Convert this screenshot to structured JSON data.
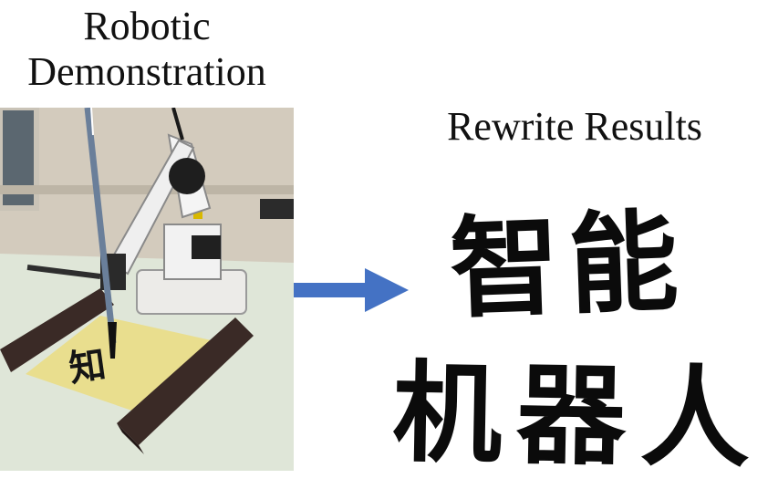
{
  "left_panel": {
    "title_line1": "Robotic",
    "title_line2": "Demonstration",
    "photo_written_char": "知"
  },
  "right_panel": {
    "title": "Rewrite Results",
    "calligraphy_line1": "智能",
    "calligraphy_line2": "机器人"
  },
  "colors": {
    "arrow": "#4472C4",
    "paper": "#E9DE8E",
    "felt": "#DDE6D6",
    "wood": "#3A2A26",
    "ink": "#0B0B0B"
  }
}
